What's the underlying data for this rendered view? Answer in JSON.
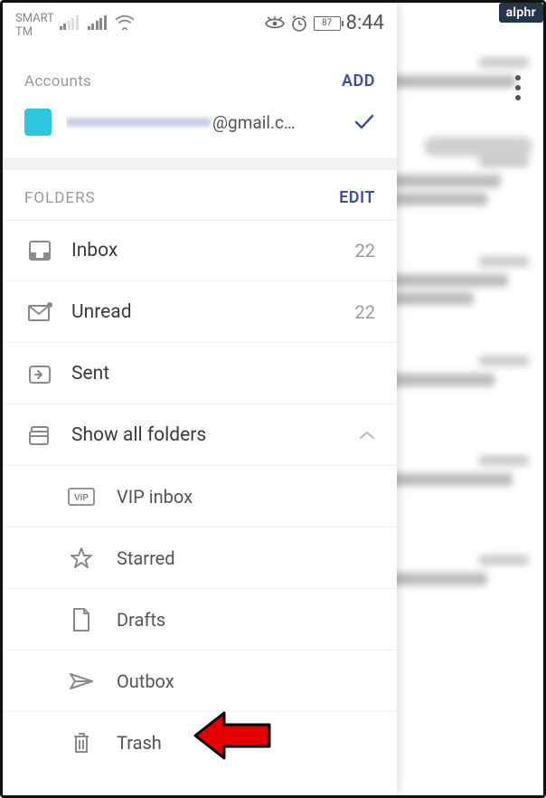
{
  "watermark": "alphr",
  "statusbar": {
    "carrier_line1": "SMART",
    "carrier_line2": "TM",
    "battery": "87",
    "time": "8:44"
  },
  "accounts": {
    "title": "Accounts",
    "action": "ADD",
    "email_suffix": "@gmail.c…"
  },
  "folders": {
    "title": "FOLDERS",
    "action": "EDIT",
    "items": [
      {
        "label": "Inbox",
        "count": "22"
      },
      {
        "label": "Unread",
        "count": "22"
      },
      {
        "label": "Sent",
        "count": ""
      },
      {
        "label": "Show all folders",
        "count": ""
      }
    ],
    "sub": [
      {
        "label": "VIP inbox"
      },
      {
        "label": "Starred"
      },
      {
        "label": "Drafts"
      },
      {
        "label": "Outbox"
      },
      {
        "label": "Trash"
      }
    ]
  }
}
